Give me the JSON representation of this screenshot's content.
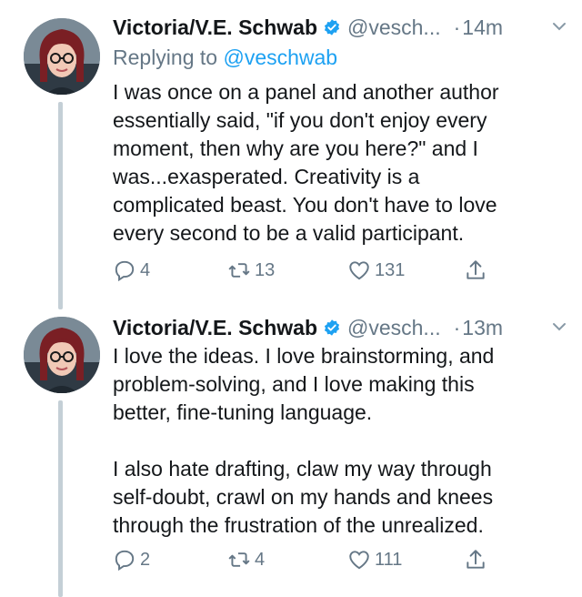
{
  "tweets": [
    {
      "author_name": "Victoria/V.E. Schwab",
      "handle": "@vesch...",
      "dot": "·",
      "time": "14m",
      "replying_prefix": "Replying to",
      "replying_to": "@veschwab",
      "text": "I was once on a panel and another author\nessentially said, \"if you don't enjoy every\nmoment, then why are you here?\" and I\nwas...exasperated. Creativity is a\ncomplicated beast. You don't have to love\nevery second to be a valid participant.",
      "replies": "4",
      "retweets": "13",
      "likes": "131"
    },
    {
      "author_name": "Victoria/V.E. Schwab",
      "handle": "@vesch...",
      "dot": "·",
      "time": "13m",
      "text": "I love the ideas. I love brainstorming, and\nproblem-solving, and I love making this\nbetter, fine-tuning language.\n\nI also hate drafting, claw my way through\nself-doubt, crawl on my hands and knees\nthrough the frustration of the unrealized.",
      "replies": "2",
      "retweets": "4",
      "likes": "111"
    }
  ],
  "colors": {
    "link": "#1da1f2",
    "secondary_text": "#657786",
    "thread_line": "#c4cfd6",
    "verified_badge": "#1da1f2"
  },
  "icons": [
    "verified-badge-icon",
    "chevron-down-icon",
    "reply-icon",
    "retweet-icon",
    "like-icon",
    "share-icon"
  ]
}
